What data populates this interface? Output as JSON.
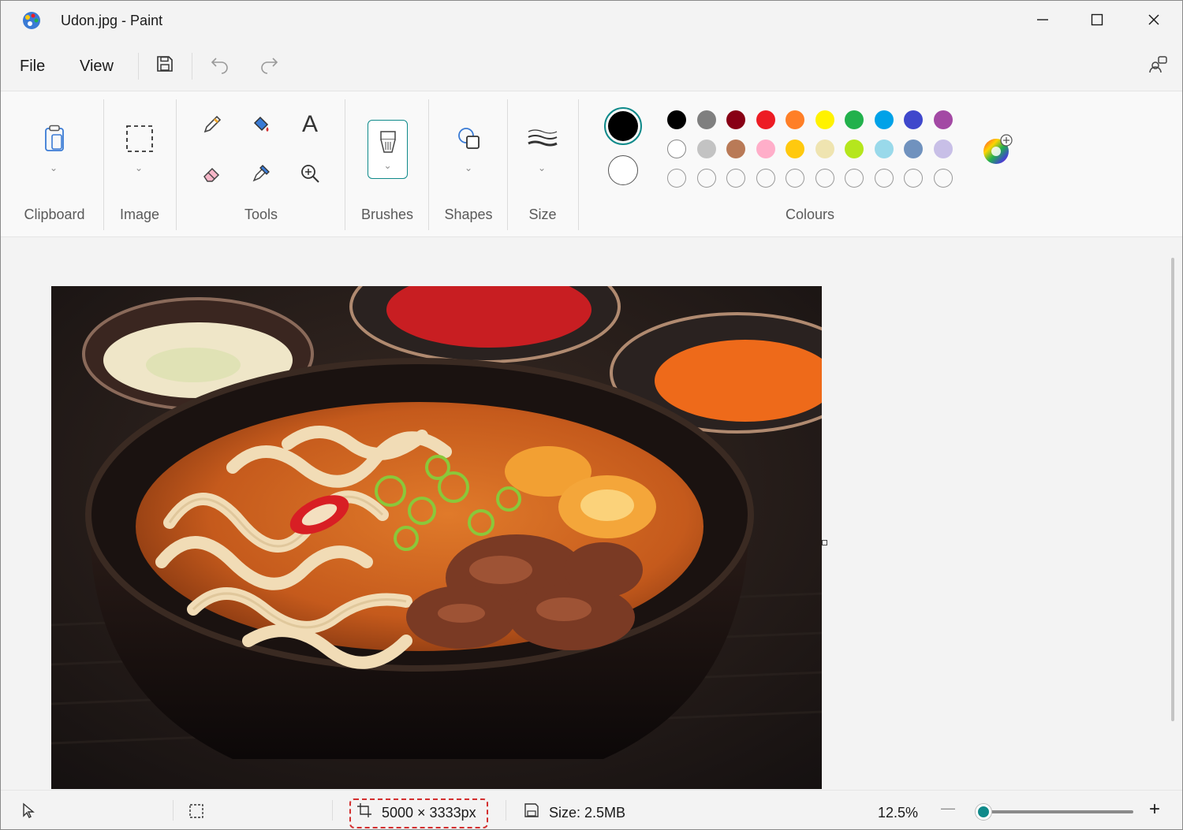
{
  "window": {
    "title": "Udon.jpg - Paint",
    "icons": {
      "app": "paint-palette-icon",
      "minimize": "minimize-icon",
      "maximize": "maximize-icon",
      "close": "close-icon"
    }
  },
  "menu": {
    "file": "File",
    "view": "View",
    "icons": {
      "save": "save-icon",
      "undo": "undo-icon",
      "redo": "redo-icon",
      "account": "account-settings-icon"
    }
  },
  "ribbon": {
    "groups": {
      "clipboard": "Clipboard",
      "image": "Image",
      "tools": "Tools",
      "brushes": "Brushes",
      "shapes": "Shapes",
      "size": "Size",
      "colours": "Colours"
    },
    "tool_icons": [
      "pencil-icon",
      "fill-bucket-icon",
      "text-icon",
      "eraser-icon",
      "color-picker-icon",
      "magnifier-icon"
    ],
    "text_tool_glyph": "A",
    "colors": {
      "primary": "#000000",
      "secondary": "#ffffff",
      "accent": "#0f8a8a",
      "palette_row1": [
        "#000000",
        "#7f7f7f",
        "#880015",
        "#ed1c24",
        "#ff7f27",
        "#fff200",
        "#22b14c",
        "#00a2e8",
        "#3f48cc",
        "#a349a4"
      ],
      "palette_row2": [
        "#ffffff",
        "#c3c3c3",
        "#b97a57",
        "#ffaec9",
        "#ffc90e",
        "#efe4b0",
        "#b5e61d",
        "#99d9ea",
        "#7092be",
        "#c8bfe7"
      ],
      "palette_row3_empty": 10
    }
  },
  "canvas": {
    "image_name": "Udon.jpg"
  },
  "status": {
    "dimensions": "5000 × 3333px",
    "size": "Size: 2.5MB",
    "zoom": "12.5%",
    "zoom_out": "—",
    "zoom_in": "+",
    "icons": {
      "pointer": "pointer-icon",
      "selection": "selection-icon",
      "canvas_size": "canvas-size-icon",
      "disk": "disk-icon"
    }
  }
}
